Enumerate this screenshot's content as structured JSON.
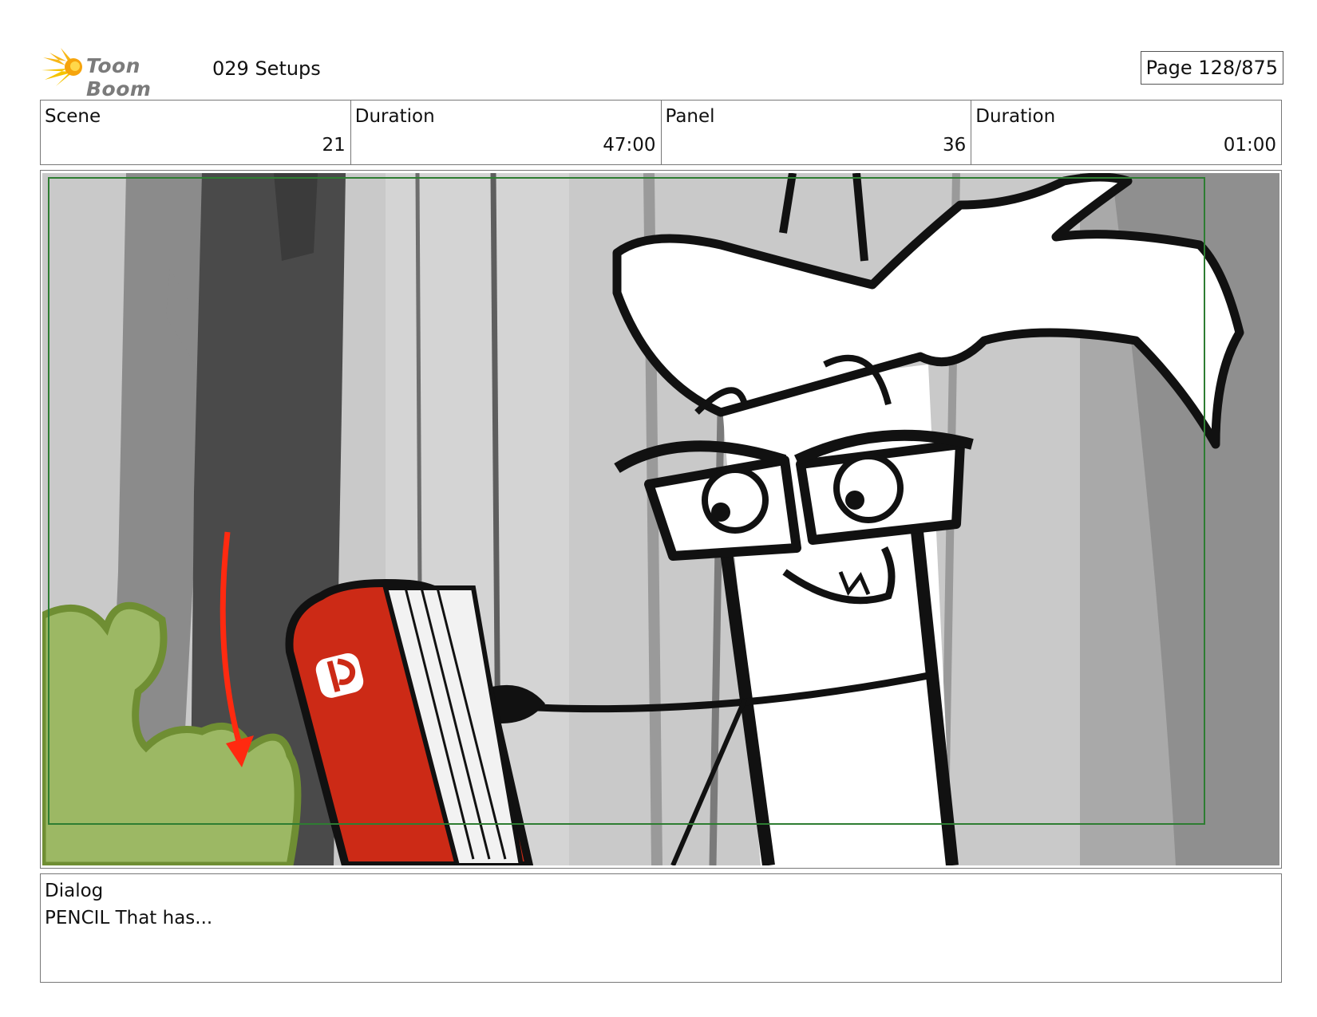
{
  "header": {
    "logo_text": "Toon Boom",
    "project_title": "029 Setups",
    "page_indicator": "Page 128/875"
  },
  "info": {
    "scene_label": "Scene",
    "scene_value": "21",
    "scene_duration_label": "Duration",
    "scene_duration_value": "47:00",
    "panel_label": "Panel",
    "panel_value": "36",
    "panel_duration_label": "Duration",
    "panel_duration_value": "01:00"
  },
  "dialog": {
    "label": "Dialog",
    "text": "PENCIL That has..."
  },
  "colors": {
    "safe_frame": "#2e7d32",
    "case_red": "#cc2a16",
    "bush_green": "#9cb864",
    "arrow_red": "#ff2a10"
  }
}
